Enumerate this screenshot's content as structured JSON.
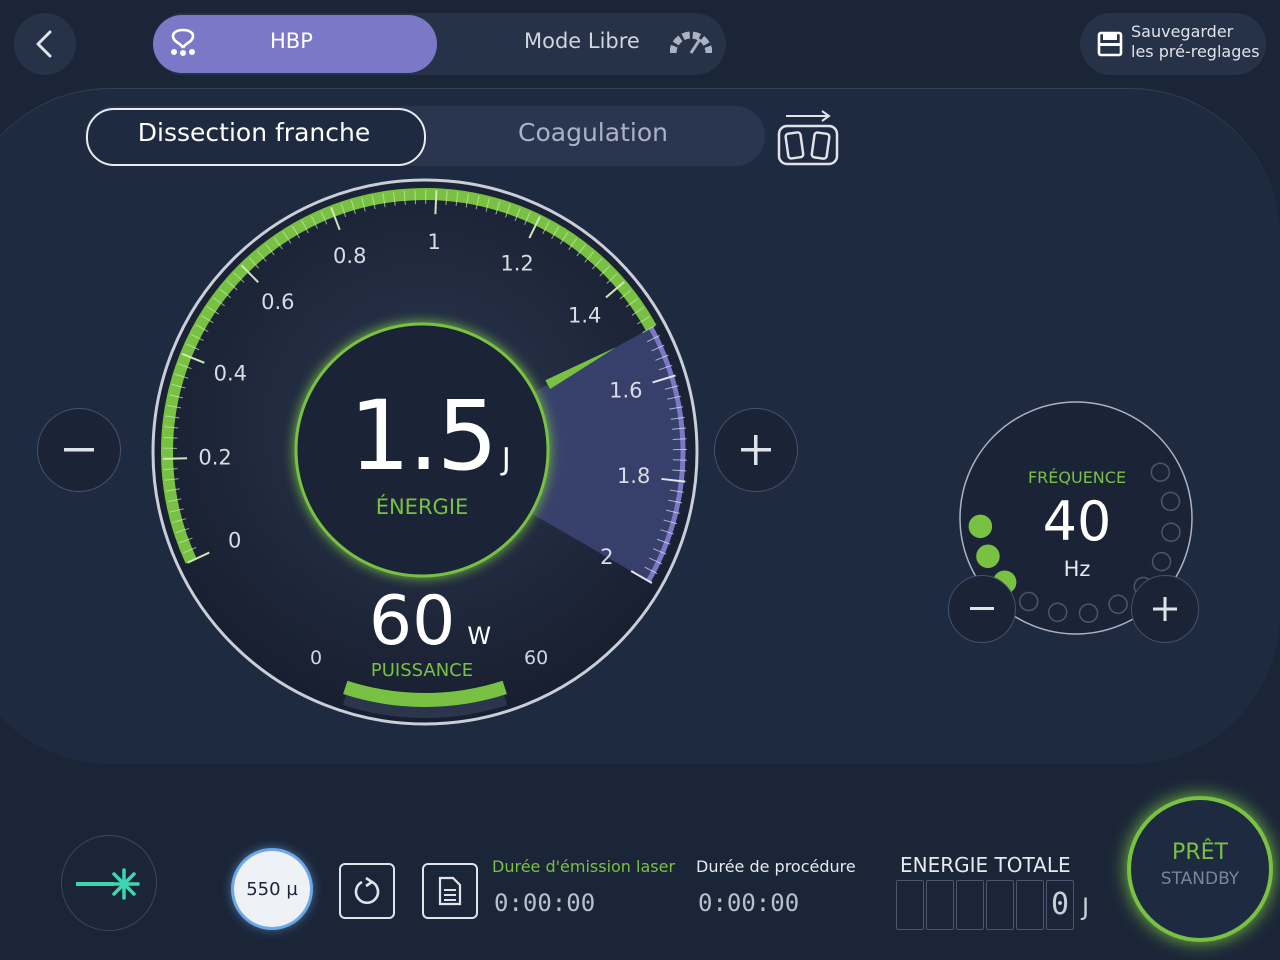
{
  "top_bar": {
    "modes": [
      {
        "label": "HBP",
        "active": true
      },
      {
        "label": "Mode Libre",
        "active": false
      }
    ],
    "save": {
      "line1": "Sauvegarder",
      "line2": "les pré-reglages"
    }
  },
  "mode_tabs": [
    {
      "label": "Dissection franche",
      "active": true
    },
    {
      "label": "Coagulation",
      "active": false
    }
  ],
  "energy_gauge": {
    "value": "1.5",
    "unit": "J",
    "label": "ÉNERGIE",
    "ticks": [
      "0",
      "0.2",
      "0.4",
      "0.6",
      "0.8",
      "1",
      "1.2",
      "1.4",
      "1.6",
      "1.8",
      "2"
    ],
    "min": 0,
    "max": 2,
    "current": 1.5
  },
  "power": {
    "value": "60",
    "unit": "W",
    "label": "PUISSANCE",
    "min_label": "0",
    "max_label": "60",
    "level_fraction": 1.0
  },
  "frequency": {
    "label": "FRÉQUENCE",
    "value": "40",
    "unit": "Hz",
    "dots_total": 12,
    "dots_active": 3
  },
  "bottom": {
    "fiber": "550 µ",
    "emission_label": "Durée d'émission laser",
    "emission_time": "0:00:00",
    "procedure_label": "Durée de procédure",
    "procedure_time": "0:00:00",
    "energy_total_label": "ENERGIE TOTALE",
    "energy_total_value": "0",
    "energy_total_unit": "J"
  },
  "ready": {
    "line1": "PRÊT",
    "line2": "STANDBY"
  },
  "colors": {
    "accent_green": "#79c143",
    "accent_purple": "#7b78c8",
    "background": "#1b2538"
  }
}
